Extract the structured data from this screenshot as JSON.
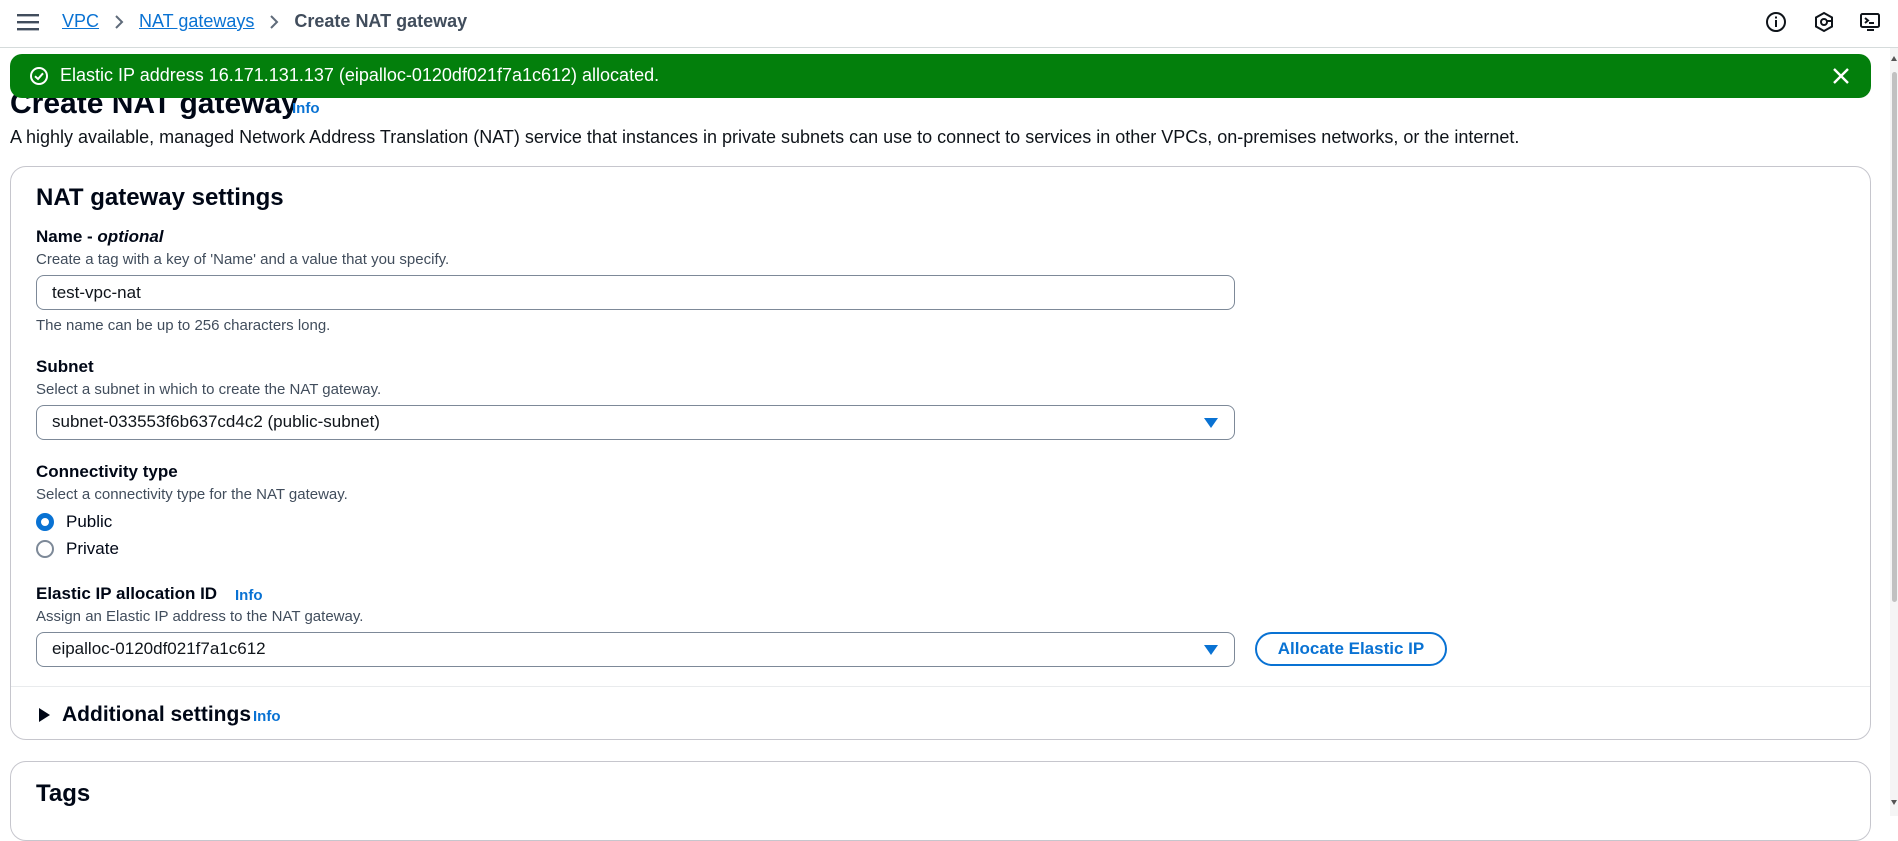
{
  "header": {
    "breadcrumbs": [
      {
        "label": "VPC"
      },
      {
        "label": "NAT gateways"
      },
      {
        "label": "Create NAT gateway"
      }
    ],
    "icons": [
      "menu-icon",
      "info-icon",
      "notifications-icon",
      "cloudshell-icon"
    ]
  },
  "banner": {
    "message": "Elastic IP address 16.171.131.137 (eipalloc-0120df021f7a1c612) allocated.",
    "icons": [
      "success-icon",
      "close-icon"
    ],
    "color": "#037f0c"
  },
  "page": {
    "title": "Create NAT gateway",
    "info": "Info",
    "description": "A highly available, managed Network Address Translation (NAT) service that instances in private subnets can use to connect to services in other VPCs, on-premises networks, or the internet."
  },
  "settings": {
    "title": "NAT gateway settings",
    "name": {
      "label": "Name - ",
      "label_optional": "optional",
      "description": "Create a tag with a key of 'Name' and a value that you specify.",
      "value": "test-vpc-nat",
      "constraint": "The name can be up to 256 characters long."
    },
    "subnet": {
      "label": "Subnet",
      "description": "Select a subnet in which to create the NAT gateway.",
      "value": "subnet-033553f6b637cd4c2 (public-subnet)"
    },
    "connectivity": {
      "label": "Connectivity type",
      "description": "Select a connectivity type for the NAT gateway.",
      "options": [
        {
          "label": "Public",
          "selected": true
        },
        {
          "label": "Private",
          "selected": false
        }
      ]
    },
    "elastic_ip": {
      "label": "Elastic IP allocation ID",
      "info": "Info",
      "description": "Assign an Elastic IP address to the NAT gateway.",
      "value": "eipalloc-0120df021f7a1c612",
      "button": "Allocate Elastic IP"
    },
    "additional": {
      "label": "Additional settings",
      "info": "Info"
    }
  },
  "tags": {
    "title": "Tags"
  },
  "colors": {
    "accent": "#0972d3",
    "success": "#037f0c"
  }
}
